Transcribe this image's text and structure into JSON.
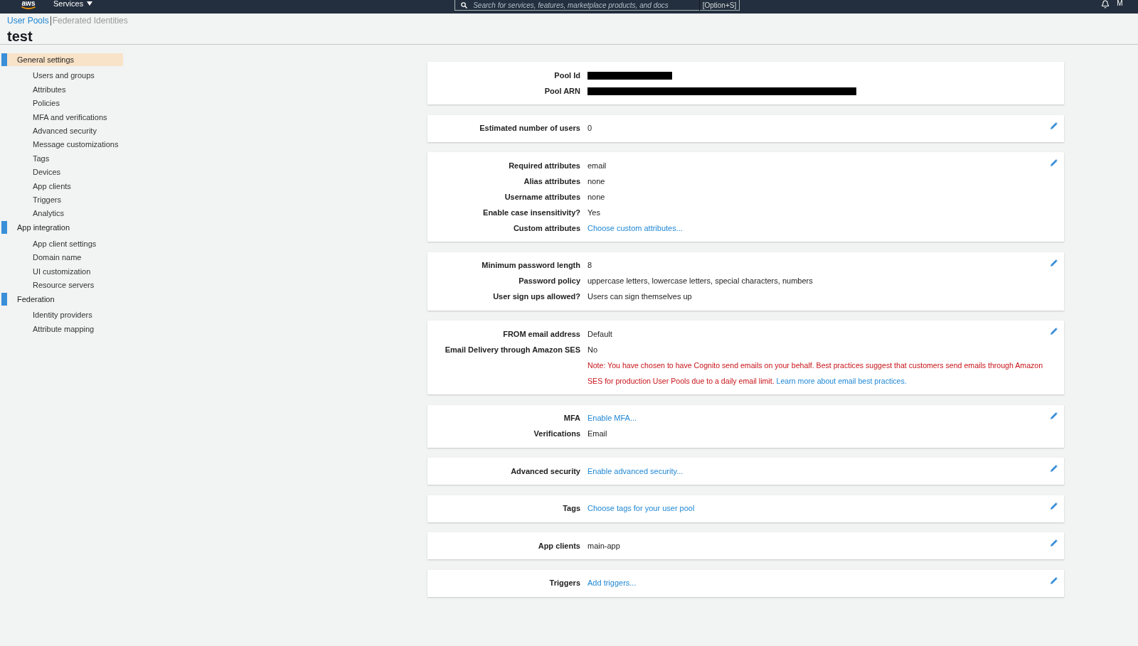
{
  "top_bar": {
    "logo": "aws",
    "services_menu": "Services",
    "search": {
      "placeholder": "Search for services, features, marketplace products, and docs",
      "shortcut": "[Option+S]"
    },
    "account": "M"
  },
  "breadcrumb": [
    {
      "label": "User Pools",
      "selected": true
    },
    {
      "label": "Federated Identities",
      "selected": false
    }
  ],
  "page_title": "test",
  "sidebar": {
    "sections": [
      {
        "label": "General settings",
        "selected": true,
        "children": [
          {
            "label": "Users and groups",
            "selected": false
          },
          {
            "label": "Attributes",
            "selected": false
          },
          {
            "label": "Policies",
            "selected": false
          },
          {
            "label": "MFA and verifications",
            "selected": false
          },
          {
            "label": "Advanced security",
            "selected": false
          },
          {
            "label": "Message customizations",
            "selected": false
          },
          {
            "label": "Tags",
            "selected": false
          },
          {
            "label": "Devices",
            "selected": false
          },
          {
            "label": "App clients",
            "selected": false
          },
          {
            "label": "Triggers",
            "selected": false
          },
          {
            "label": "Analytics",
            "selected": false
          }
        ]
      },
      {
        "label": "App integration",
        "selected": false,
        "children": [
          {
            "label": "App client settings",
            "selected": false
          },
          {
            "label": "Domain name",
            "selected": false
          },
          {
            "label": "UI customization",
            "selected": false
          },
          {
            "label": "Resource servers",
            "selected": false
          }
        ]
      },
      {
        "label": "Federation",
        "selected": false,
        "children": [
          {
            "label": "Identity providers",
            "selected": false
          },
          {
            "label": "Attribute mapping",
            "selected": false
          }
        ]
      }
    ]
  },
  "cards": [
    {
      "editable": false,
      "rows": [
        {
          "label": "Pool Id",
          "kind": "redacted"
        },
        {
          "label": "Pool ARN",
          "kind": "redacted"
        }
      ]
    },
    {
      "editable": true,
      "rows": [
        {
          "label": "Estimated number of users",
          "kind": "text",
          "value": "0"
        }
      ]
    },
    {
      "editable": true,
      "rows": [
        {
          "label": "Required attributes",
          "kind": "text",
          "value": "email"
        },
        {
          "label": "Alias attributes",
          "kind": "text",
          "value": "none"
        },
        {
          "label": "Username attributes",
          "kind": "text",
          "value": "none"
        },
        {
          "label": "Enable case insensitivity?",
          "kind": "text",
          "value": "Yes"
        },
        {
          "label": "Custom attributes",
          "kind": "link",
          "value": "Choose custom attributes..."
        }
      ]
    },
    {
      "editable": true,
      "rows": [
        {
          "label": "Minimum password length",
          "kind": "text",
          "value": "8"
        },
        {
          "label": "Password policy",
          "kind": "text",
          "value": "uppercase letters, lowercase letters, special characters, numbers"
        },
        {
          "label": "User sign ups allowed?",
          "kind": "text",
          "value": "Users can sign themselves up"
        }
      ]
    },
    {
      "editable": true,
      "rows": [
        {
          "label": "FROM email address",
          "kind": "text",
          "value": "Default"
        },
        {
          "label": "Email Delivery through Amazon SES",
          "kind": "text",
          "value": "No"
        }
      ],
      "note": {
        "text": "Note: You have chosen to have Cognito send emails on your behalf. Best practices suggest that customers send emails through Amazon SES for production User Pools due to a daily email limit.",
        "link": "Learn more about email best practices."
      }
    },
    {
      "editable": true,
      "rows": [
        {
          "label": "MFA",
          "kind": "link",
          "value": "Enable MFA..."
        },
        {
          "label": "Verifications",
          "kind": "text",
          "value": "Email"
        }
      ]
    },
    {
      "editable": true,
      "rows": [
        {
          "label": "Advanced security",
          "kind": "link",
          "value": "Enable advanced security..."
        }
      ]
    },
    {
      "editable": true,
      "rows": [
        {
          "label": "Tags",
          "kind": "link",
          "value": "Choose tags for your user pool"
        }
      ]
    },
    {
      "editable": true,
      "rows": [
        {
          "label": "App clients",
          "kind": "text",
          "value": "main-app"
        }
      ]
    },
    {
      "editable": true,
      "rows": [
        {
          "label": "Triggers",
          "kind": "link",
          "value": "Add triggers..."
        }
      ]
    }
  ]
}
